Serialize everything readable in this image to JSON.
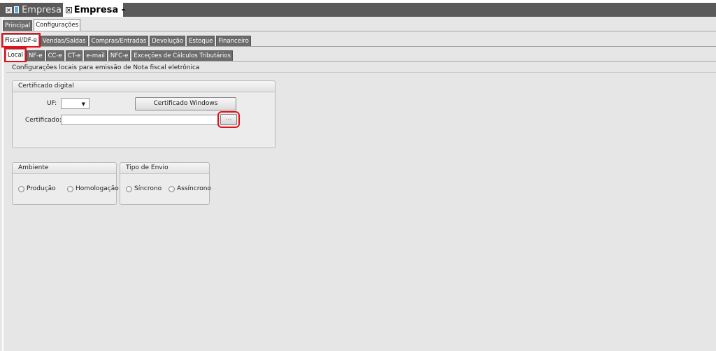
{
  "window_tabs": [
    {
      "label": "Empresa",
      "active": false
    },
    {
      "label": "Empresa -",
      "active": true
    }
  ],
  "tabs_level1": [
    {
      "label": "Principal",
      "selected": false
    },
    {
      "label": "Configurações",
      "selected": true
    }
  ],
  "tabs_level2": [
    {
      "label": "Fiscal/DF-e",
      "selected": true
    },
    {
      "label": "Vendas/Saídas"
    },
    {
      "label": "Compras/Entradas"
    },
    {
      "label": "Devolução"
    },
    {
      "label": "Estoque"
    },
    {
      "label": "Financeiro"
    }
  ],
  "tabs_level3": [
    {
      "label": "Local",
      "selected": true
    },
    {
      "label": "NF-e"
    },
    {
      "label": "CC-e"
    },
    {
      "label": "CT-e"
    },
    {
      "label": "e-mail"
    },
    {
      "label": "NFC-e"
    },
    {
      "label": "Exceções de Cálculos Tributários"
    }
  ],
  "caption": "Configurações locais para emissão de Nota fiscal eletrônica",
  "certificado_group": {
    "title": "Certificado digital",
    "uf_label": "UF:",
    "uf_value": "",
    "windows_button": "Certificado Windows",
    "cert_label": "Certificado:",
    "cert_value": "",
    "browse_button": "..."
  },
  "ambiente_group": {
    "title": "Ambiente",
    "options": [
      "Produção",
      "Homologação"
    ]
  },
  "tipo_envio_group": {
    "title": "Tipo de Envio",
    "options": [
      "Síncrono",
      "Assíncrono"
    ]
  },
  "colors": {
    "highlight": "#e3101b",
    "window_bar": "#5a5a5a",
    "panel": "#e6e6e6"
  }
}
